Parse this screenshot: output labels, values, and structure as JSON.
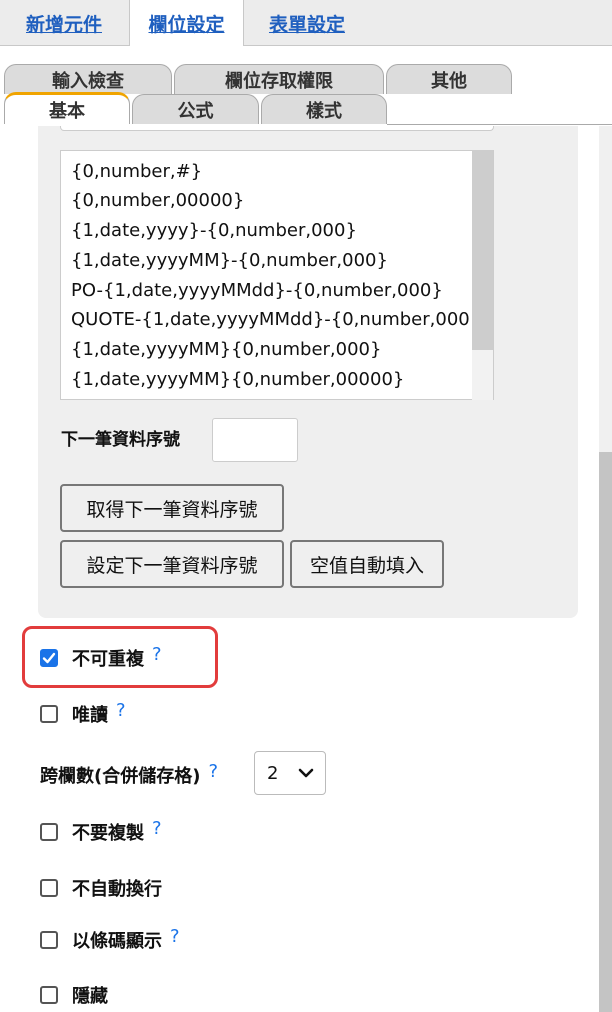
{
  "top_tabs": [
    "新增元件",
    "欄位設定",
    "表單設定"
  ],
  "sub_tabs_row1": [
    "輸入檢查",
    "欄位存取權限",
    "其他"
  ],
  "sub_tabs_row2": [
    "基本",
    "公式",
    "樣式"
  ],
  "format_list": [
    "{0,number,#}",
    "{0,number,00000}",
    "{1,date,yyyy}-{0,number,000}",
    "{1,date,yyyyMM}-{0,number,000}",
    "PO-{1,date,yyyyMMdd}-{0,number,000}",
    "QUOTE-{1,date,yyyyMMdd}-{0,number,000}",
    "{1,date,yyyyMM}{0,number,000}",
    "{1,date,yyyyMM}{0,number,00000}"
  ],
  "next_serial": {
    "label": "下一筆資料序號",
    "value": ""
  },
  "buttons": {
    "get_next": "取得下一筆資料序號",
    "set_next": "設定下一筆資料序號",
    "auto_fill": "空值自動填入"
  },
  "options": {
    "no_duplicate": {
      "label": "不可重複",
      "checked": true,
      "help": "?"
    },
    "read_only": {
      "label": "唯讀",
      "checked": false,
      "help": "?"
    },
    "colspan": {
      "label": "跨欄數(合併儲存格)",
      "help": "?",
      "value": "2"
    },
    "no_copy": {
      "label": "不要複製",
      "checked": false,
      "help": "?"
    },
    "no_wrap": {
      "label": "不自動換行",
      "checked": false
    },
    "barcode": {
      "label": "以條碼顯示",
      "checked": false,
      "help": "?"
    },
    "hidden": {
      "label": "隱藏",
      "checked": false
    }
  },
  "colors": {
    "link": "#1f5fbf",
    "accent": "#1a73e8",
    "active_tab_border": "#f0a400",
    "highlight": "#e23c3c"
  }
}
